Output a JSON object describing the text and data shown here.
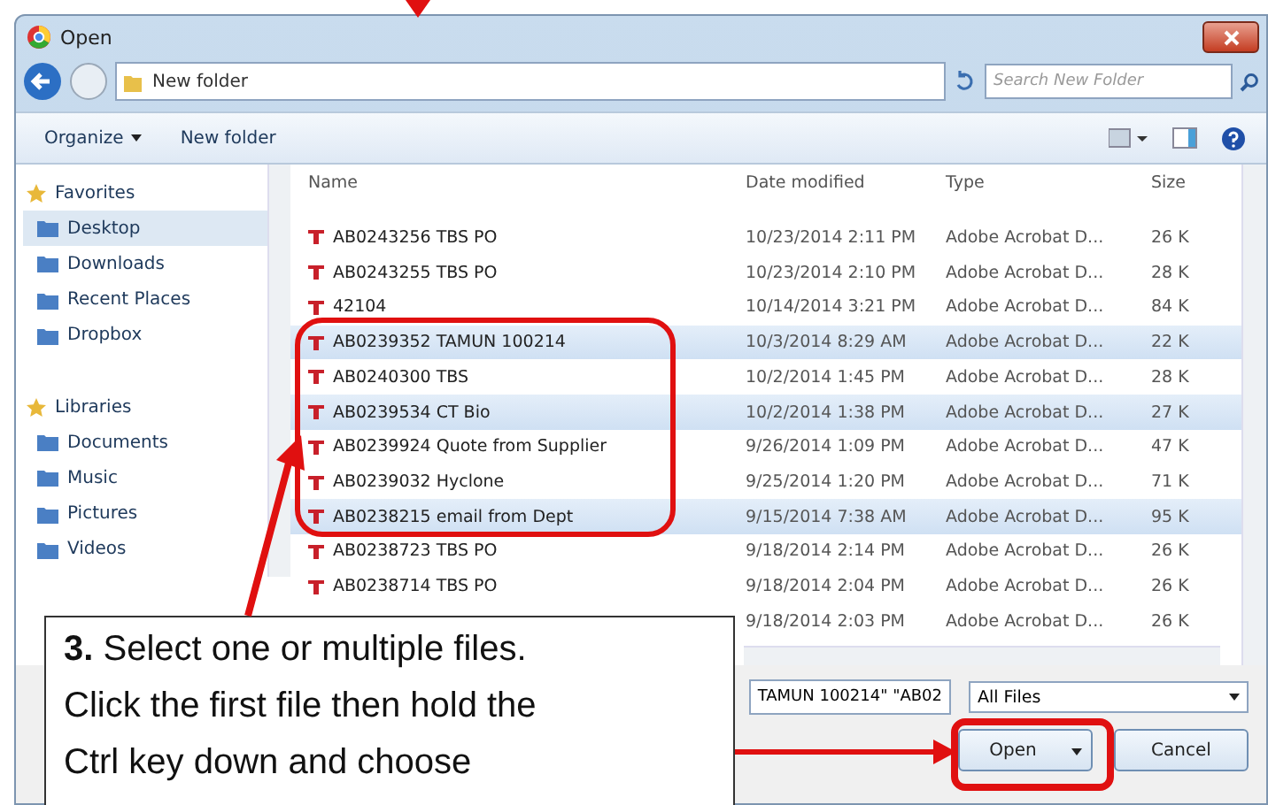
{
  "window": {
    "title": "Open"
  },
  "address": {
    "path": "New folder",
    "search_placeholder": "Search New Folder"
  },
  "toolbar": {
    "organize": "Organize",
    "new_folder": "New folder"
  },
  "sidebar": {
    "items": [
      {
        "label": "Favorites",
        "kind": "group"
      },
      {
        "label": "Desktop",
        "kind": "item",
        "selected": true
      },
      {
        "label": "Downloads",
        "kind": "item",
        "selected": false
      },
      {
        "label": "Recent Places",
        "kind": "item",
        "selected": false
      },
      {
        "label": "Dropbox",
        "kind": "item",
        "selected": false
      },
      {
        "label": "Libraries",
        "kind": "group"
      },
      {
        "label": "Documents",
        "kind": "item",
        "selected": false
      },
      {
        "label": "Music",
        "kind": "item",
        "selected": false
      },
      {
        "label": "Pictures",
        "kind": "item",
        "selected": false
      },
      {
        "label": "Videos",
        "kind": "item",
        "selected": false
      }
    ]
  },
  "table": {
    "columns": [
      "Name",
      "Date modified",
      "Type",
      "Size"
    ],
    "rows": [
      {
        "name": "AB0243256 TBS PO",
        "date": "10/23/2014 2:11 PM",
        "type": "Adobe Acrobat D...",
        "size": "26 K",
        "selected": false
      },
      {
        "name": "AB0243255 TBS PO",
        "date": "10/23/2014 2:10 PM",
        "type": "Adobe Acrobat D...",
        "size": "28 K",
        "selected": false
      },
      {
        "name": "42104",
        "date": "10/14/2014 3:21 PM",
        "type": "Adobe Acrobat D...",
        "size": "84 K",
        "selected": false
      },
      {
        "name": "AB0239352 TAMUN 100214",
        "date": "10/3/2014 8:29 AM",
        "type": "Adobe Acrobat D...",
        "size": "22 K",
        "selected": true
      },
      {
        "name": "AB0240300 TBS",
        "date": "10/2/2014 1:45 PM",
        "type": "Adobe Acrobat D...",
        "size": "28 K",
        "selected": false
      },
      {
        "name": "AB0239534 CT Bio",
        "date": "10/2/2014 1:38 PM",
        "type": "Adobe Acrobat D...",
        "size": "27 K",
        "selected": true
      },
      {
        "name": "AB0239924 Quote from Supplier",
        "date": "9/26/2014 1:09 PM",
        "type": "Adobe Acrobat D...",
        "size": "47 K",
        "selected": false
      },
      {
        "name": "AB0239032 Hyclone",
        "date": "9/25/2014 1:20 PM",
        "type": "Adobe Acrobat D...",
        "size": "71 K",
        "selected": false
      },
      {
        "name": "AB0238215 email from Dept",
        "date": "9/15/2014 7:38 AM",
        "type": "Adobe Acrobat D...",
        "size": "95 K",
        "selected": true
      },
      {
        "name": "AB0238723 TBS PO",
        "date": "9/18/2014 2:14 PM",
        "type": "Adobe Acrobat D...",
        "size": "26 K",
        "selected": false
      },
      {
        "name": "AB0238714 TBS PO",
        "date": "9/18/2014 2:04 PM",
        "type": "Adobe Acrobat D...",
        "size": "26 K",
        "selected": false
      },
      {
        "date": "9/18/2014 2:03 PM",
        "type": "Adobe Acrobat D...",
        "size": "26 K",
        "selected": false
      }
    ]
  },
  "file_name": {
    "value": "TAMUN 100214\" \"AB02"
  },
  "file_type": {
    "value": "All Files"
  },
  "buttons": {
    "open": "Open",
    "cancel": "Cancel"
  },
  "callout": {
    "step": "3.",
    "lines": [
      "Select one or multiple files.",
      "Click the first file then hold the",
      "Ctrl key down and choose"
    ]
  }
}
